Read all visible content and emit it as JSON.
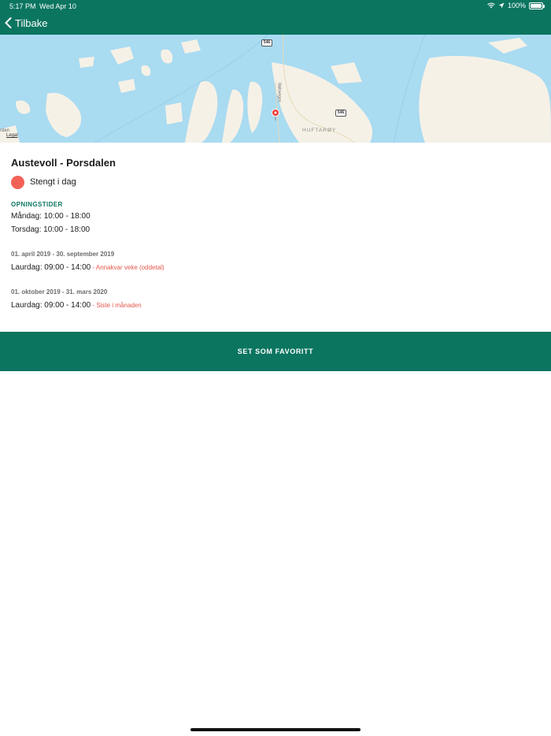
{
  "status_bar": {
    "time": "5:17 PM",
    "date": "Wed Apr 10",
    "battery": "100%",
    "battery_level": 1.0,
    "icons": [
      "wifi-icon",
      "location-arrow-icon",
      "battery-icon"
    ]
  },
  "nav": {
    "back_label": "Tilbake",
    "back_icon": "chevron-left-icon"
  },
  "map": {
    "legal": "Legal",
    "edge_label": "rden",
    "place_label": "HUFTARØY",
    "road_label": "Stølsvegen",
    "road_shield_1": "546",
    "road_shield_2": "546",
    "pin_icon": "map-pin-icon"
  },
  "place": {
    "title": "Austevoll - Porsdalen",
    "status_text": "Stengt i dag",
    "status_color": "#f36256"
  },
  "opening_hours": {
    "heading": "OPNINGSTIDER",
    "lines": [
      "Måndag: 10:00 - 18:00",
      "Torsdag: 10:00 - 18:00"
    ]
  },
  "periods": [
    {
      "title": "01. april 2019 - 30. september 2019",
      "hours": "Laurdag: 09:00 - 14:00",
      "note": " - Annakvar veke (oddetal)"
    },
    {
      "title": "01. oktober 2019 - 31. mars 2020",
      "hours": "Laurdag: 09:00 - 14:00",
      "note": " - Siste i månaden"
    }
  ],
  "favorite_button": {
    "label": "SET SOM FAVORITT"
  },
  "colors": {
    "brand": "#0b7560",
    "status_closed": "#f36256",
    "note": "#e4564a",
    "map_water": "#a9dbf1",
    "map_land": "#f6f1e7"
  }
}
